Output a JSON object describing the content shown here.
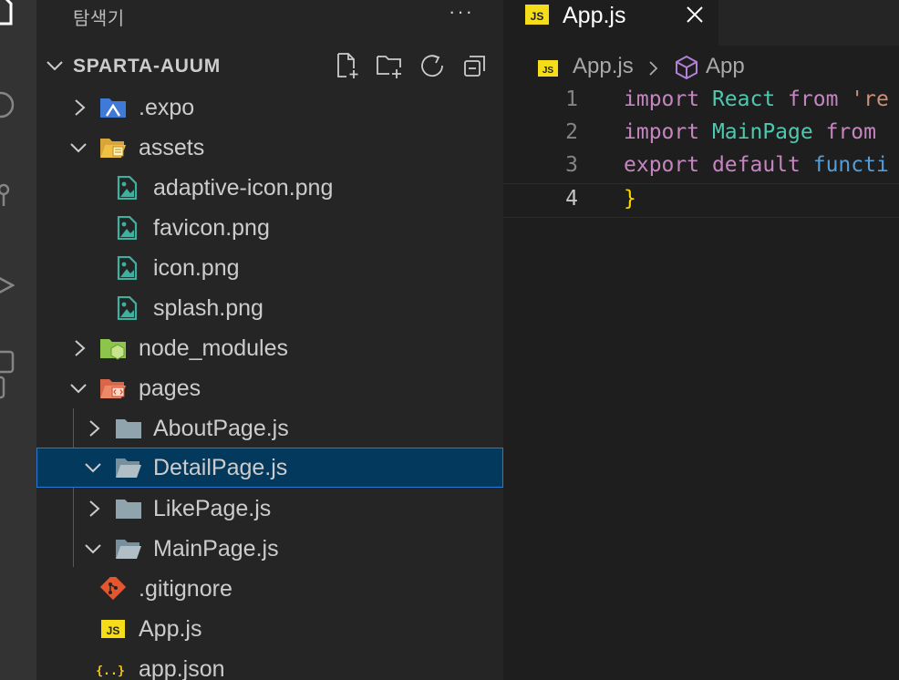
{
  "sidebar": {
    "title": "탐색기",
    "more_label": "···",
    "workspace": "SPARTA-AUUM",
    "tree": [
      {
        "label": ".expo",
        "kind": "folder",
        "icon": "expo-folder-icon",
        "expanded": false
      },
      {
        "label": "assets",
        "kind": "folder",
        "icon": "assets-folder-icon",
        "expanded": true
      },
      {
        "label": "adaptive-icon.png",
        "kind": "file",
        "icon": "image-file-icon"
      },
      {
        "label": "favicon.png",
        "kind": "file",
        "icon": "image-file-icon"
      },
      {
        "label": "icon.png",
        "kind": "file",
        "icon": "image-file-icon"
      },
      {
        "label": "splash.png",
        "kind": "file",
        "icon": "image-file-icon"
      },
      {
        "label": "node_modules",
        "kind": "folder",
        "icon": "node-folder-icon",
        "expanded": false
      },
      {
        "label": "pages",
        "kind": "folder",
        "icon": "pages-folder-icon",
        "expanded": true
      },
      {
        "label": "AboutPage.js",
        "kind": "folder",
        "icon": "folder-icon",
        "expanded": false
      },
      {
        "label": "DetailPage.js",
        "kind": "folder",
        "icon": "folder-open-icon",
        "expanded": true,
        "selected": true
      },
      {
        "label": "LikePage.js",
        "kind": "folder",
        "icon": "folder-icon",
        "expanded": false
      },
      {
        "label": "MainPage.js",
        "kind": "folder",
        "icon": "folder-open-icon",
        "expanded": true
      },
      {
        "label": ".gitignore",
        "kind": "file",
        "icon": "git-icon"
      },
      {
        "label": "App.js",
        "kind": "file",
        "icon": "js-file-icon"
      },
      {
        "label": "app.json",
        "kind": "file",
        "icon": "json-file-icon"
      }
    ]
  },
  "editor": {
    "tab_label": "App.js",
    "js_badge": "JS",
    "json_badge": "{..}",
    "breadcrumb_file": "App.js",
    "breadcrumb_symbol": "App",
    "lines": [
      {
        "num": "1",
        "parts": [
          {
            "t": "import",
            "c": "kw"
          },
          {
            "t": " React ",
            "c": "ty"
          },
          {
            "t": "from",
            "c": "kw"
          },
          {
            "t": " 're",
            "c": "st"
          }
        ]
      },
      {
        "num": "2",
        "parts": [
          {
            "t": "import",
            "c": "kw"
          },
          {
            "t": " MainPage ",
            "c": "ty"
          },
          {
            "t": "from",
            "c": "kw"
          }
        ]
      },
      {
        "num": "3",
        "parts": [
          {
            "t": "export",
            "c": "kw"
          },
          {
            "t": " default ",
            "c": "kw"
          },
          {
            "t": "functi",
            "c": "fn"
          }
        ]
      },
      {
        "num": "4",
        "parts": [
          {
            "t": "}",
            "c": "br"
          }
        ]
      }
    ]
  },
  "colors": {
    "sidebar_bg": "#252526",
    "selection_bg": "#04395e",
    "selection_border": "#2b79d0",
    "js_yellow": "#f5de19",
    "image_teal": "#3bb2a0"
  }
}
